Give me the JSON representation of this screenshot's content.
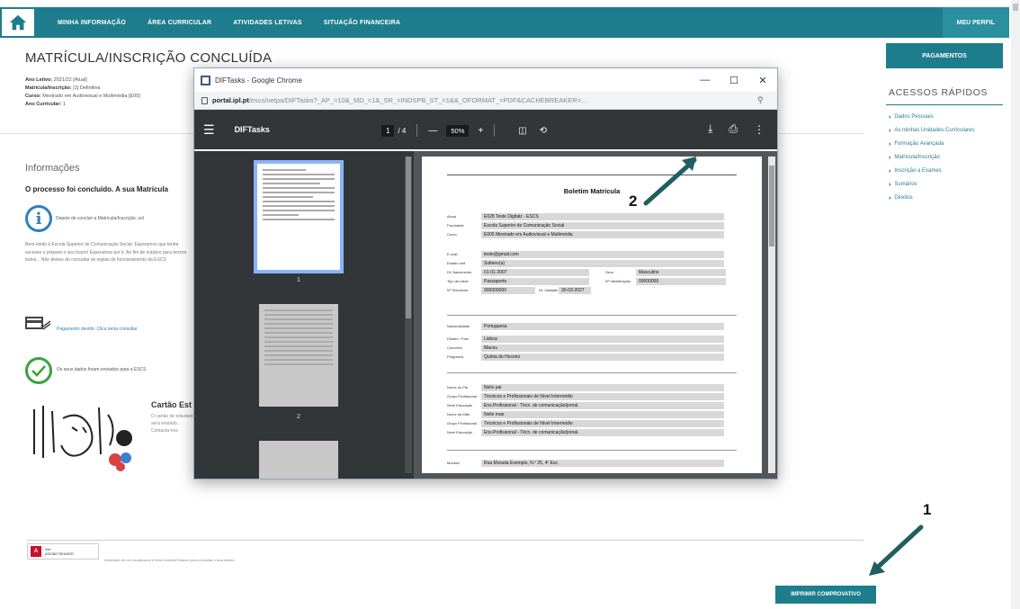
{
  "nav": {
    "items": [
      "MINHA INFORMAÇÃO",
      "ÁREA CURRICULAR",
      "ATIVIDADES LETIVAS",
      "SITUAÇÃO FINANCEIRA"
    ],
    "right": "MEU PERFIL"
  },
  "main": {
    "title": "MATRÍCULA/INSCRIÇÃO CONCLUÍDA",
    "meta": [
      {
        "label": "Ano Letivo:",
        "value": "2021/22 [Atual]"
      },
      {
        "label": "Matrícula/Inscrição:",
        "value": "[1] Definitiva"
      },
      {
        "label": "Curso:",
        "value": "Mestrado em Audiovisual e Multimédia [E05]"
      },
      {
        "label": "Ano Curricular:",
        "value": "1"
      }
    ],
    "info_title": "Informações",
    "info_bold": "O processo foi concluído. A sua Matrícula",
    "info_icon_text": "Depois de concluir a Matrícula/Inscrição, sol",
    "paragraph": "Bem-vindo à Escola Superior de Comunicação Social. Esperamos que tenha sucesso e prepare o seu futuro! Esperamos por ti. Ao fim de outubro para termos todos... Não deixes de consultar as regras de funcionamento da ESCS",
    "payment_text": "Pagamento devido: Clica tenta consultar",
    "check_text": "Os seus dados foram enviados para a ESCS",
    "card_title": "Cartão Est",
    "card_text": "O cartão do estudante será enviado... Contacta-nos"
  },
  "bottom": {
    "reader_line1": "Get",
    "reader_line2": "ADOBE READER",
    "reader_note": "Necessita de um visualizador e leitor Acrobat Reader para consultar o documento",
    "print_button": "IMPRIMIR COMPROVATIVO"
  },
  "sidebar": {
    "button": "PAGAMENTOS",
    "title": "ACESSOS RÁPIDOS",
    "items": [
      "Dados Pessoais",
      "As minhas Unidades Curriculares",
      "Formação Avançada",
      "Matrícula/Inscrição",
      "Inscrição a Exames",
      "Sumários",
      "Direitos"
    ]
  },
  "chrome": {
    "title": "DIFTasks - Google Chrome",
    "url_host": "portal.ipl.pt",
    "url_path": "/escs/netpa/DIFTasks?_AP_=10&_MD_=1&_SR_=INDSPB_ST_=1&&_OFORMAT_=PDF&CACHEBREAKER=...",
    "pdf_name": "DIFTasks",
    "page_current": "1",
    "page_total": "/ 4",
    "zoom": "50%",
    "thumb_labels": [
      "1",
      "2"
    ]
  },
  "document": {
    "title": "Boletim Matrícula",
    "rows": [
      {
        "label": "Aluno",
        "value": "E028        Teste Digitalz - ESCS"
      },
      {
        "label": "Faculdade",
        "value": "Escola Superior de Comunicação Social"
      },
      {
        "label": "Curso",
        "value": "E005        Mestrado em Audiovisual e Multimédia"
      },
      {
        "label": "E-mail",
        "value": "teste@gmail.com"
      },
      {
        "label": "Estado civil",
        "value": "Solteiro(a)"
      },
      {
        "label": "Dt. Nascimento",
        "value": "01-01-2007"
      },
      {
        "label": "Tipo de Ident.",
        "value": "Passaporte"
      },
      {
        "label": "Nº Telemóvel",
        "value": "900000000"
      },
      {
        "label": "Nacionalidade",
        "value": "Portuguesa"
      },
      {
        "label": "Distrito / País",
        "value": "Lisboa"
      },
      {
        "label": "Concelho",
        "value": "Maceu"
      },
      {
        "label": "Freguesia",
        "value": "Quinta do Hoceiro"
      },
      {
        "label": "Nome do Pai",
        "value": "Nelio pai"
      },
      {
        "label": "Grupo Profissional",
        "value": "Técnicos e Profissionais de Nível Intermédio"
      },
      {
        "label": "Nível Educação",
        "value": "Ens.Profissional - Técn. de comunicação/jornal."
      },
      {
        "label": "Nome da Mãe",
        "value": "Nelio mae"
      },
      {
        "label": "Grupo Profissional",
        "value": "Técnicos e Profissionais de Nível Intermédio"
      },
      {
        "label": "Nível Educação",
        "value": "Ens.Profissional - Técn. de comunicação/jornal."
      },
      {
        "label": "Morada",
        "value": "Rua Morada Exemplo, N.º 25, 4º Esc."
      }
    ],
    "side_values": [
      {
        "label": "Sexo",
        "value": "Masculino"
      },
      {
        "label": "Nº Identificação",
        "value": "00000000"
      },
      {
        "label": "Dt. Validade",
        "value": "30-03-2027"
      }
    ]
  },
  "annotations": [
    "1",
    "2"
  ]
}
